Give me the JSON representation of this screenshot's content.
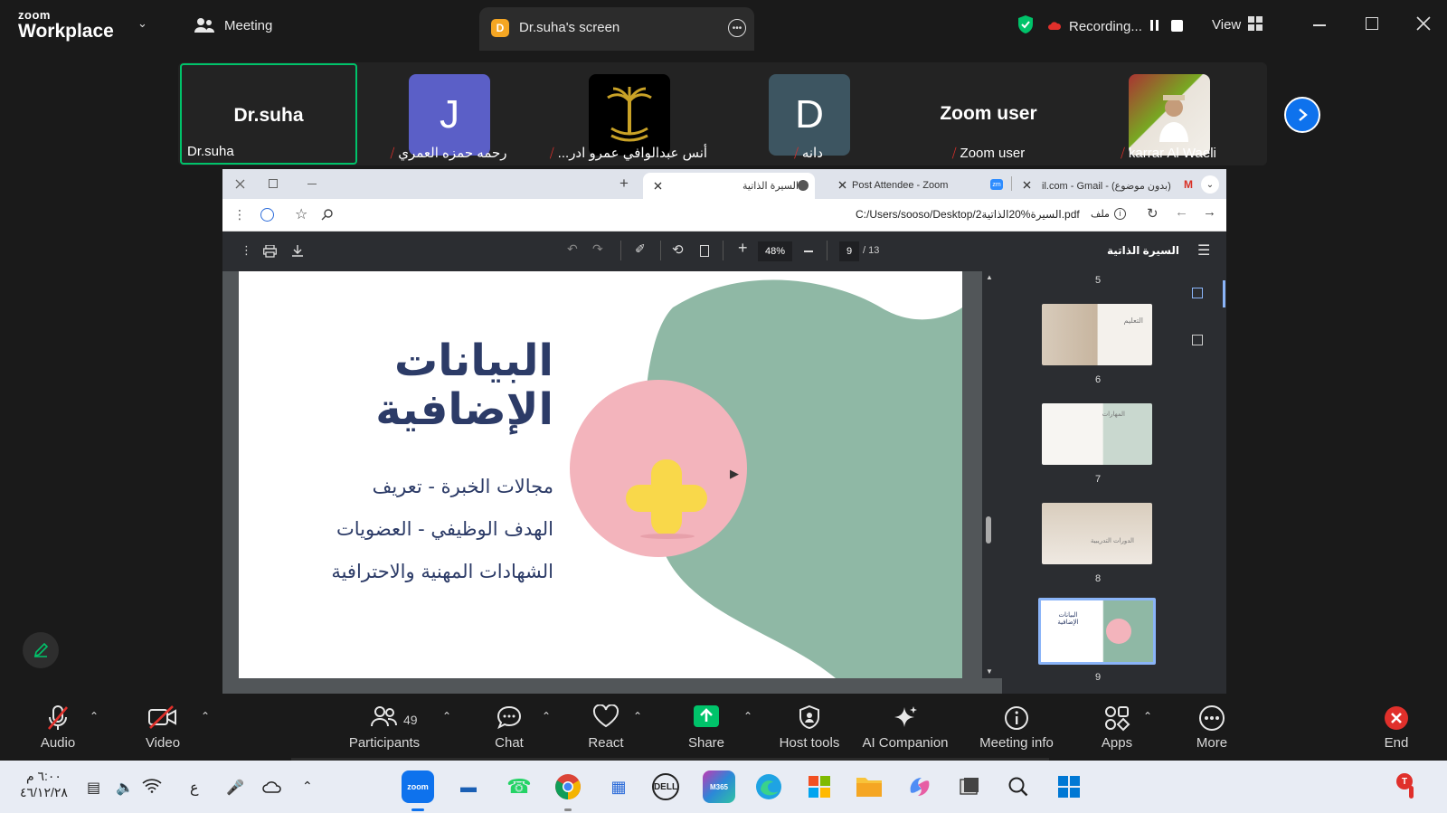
{
  "zoom": {
    "logo_top": "zoom",
    "logo_bottom": "Workplace",
    "meeting_label": "Meeting",
    "share_tab_label": "Dr.suha's screen",
    "share_badge": "D",
    "recording_label": "Recording...",
    "view_label": "View"
  },
  "participants": [
    {
      "name": "Dr.suha",
      "display": "Dr.suha",
      "active": true,
      "muted": false
    },
    {
      "name": "رحمه حمزه العمري",
      "display": "J",
      "avatar_color": "#5b5fc7",
      "muted": true
    },
    {
      "name": "...أنس عبدالوافي عمرو ادر",
      "display": "",
      "avatar_color": "#000000",
      "muted": true
    },
    {
      "name": "دانه",
      "display": "D",
      "avatar_color": "#3d5561",
      "muted": true
    },
    {
      "name": "Zoom user",
      "display": "Zoom user",
      "muted": true
    },
    {
      "name": "karrar Al Waeli",
      "display": "",
      "avatar_color": "#8a6b52",
      "muted": true
    }
  ],
  "browser": {
    "tabs": [
      {
        "label": "السيرة الذاتية",
        "active": true
      },
      {
        "label": "Post Attendee - Zoom",
        "active": false
      },
      {
        "label": "il.com - Gmail - (بدون موضوع)",
        "active": false
      }
    ],
    "address": "C:/Users/sooso/Desktop/السيرة%20الذاتية2.pdf",
    "address_prefix": "ملف"
  },
  "pdf": {
    "zoom_level": "48%",
    "page_current": "9",
    "page_total": "/ 13",
    "doc_title": "السيرة الذاتية",
    "slide": {
      "title_line1": "البيانات",
      "title_line2": "الإضافية",
      "line1": "مجالات الخبرة - تعريف",
      "line2": "الهدف الوظيفي - العضويات",
      "line3": "الشهادات المهنية والاحترافية"
    },
    "thumbnails": [
      {
        "num": "5"
      },
      {
        "num": "6",
        "caption": "التعليم"
      },
      {
        "num": "7",
        "caption": "المهارات"
      },
      {
        "num": "8",
        "caption": "الدورات التدريبية"
      },
      {
        "num": "9",
        "caption": "البيانات الإضافية",
        "active": true
      }
    ]
  },
  "toolbar": {
    "audio": "Audio",
    "video": "Video",
    "participants": "Participants",
    "participants_count": "49",
    "chat": "Chat",
    "react": "React",
    "share": "Share",
    "host_tools": "Host tools",
    "ai_companion": "AI Companion",
    "meeting_info": "Meeting info",
    "apps": "Apps",
    "more": "More",
    "end": "End"
  },
  "taskbar": {
    "time": "٦:٠٠ م",
    "date": "٤٦/١٢/٢٨",
    "lang": "ع",
    "notification_badge": "T"
  },
  "colors": {
    "zoom_green": "#00c36a",
    "zoom_blue": "#0e72ed",
    "end_red": "#e0302b",
    "slide_blob": "#8fb8a5",
    "slide_circle": "#f3b4bc",
    "slide_plus": "#f9d84a",
    "slide_text": "#2c3b67"
  }
}
